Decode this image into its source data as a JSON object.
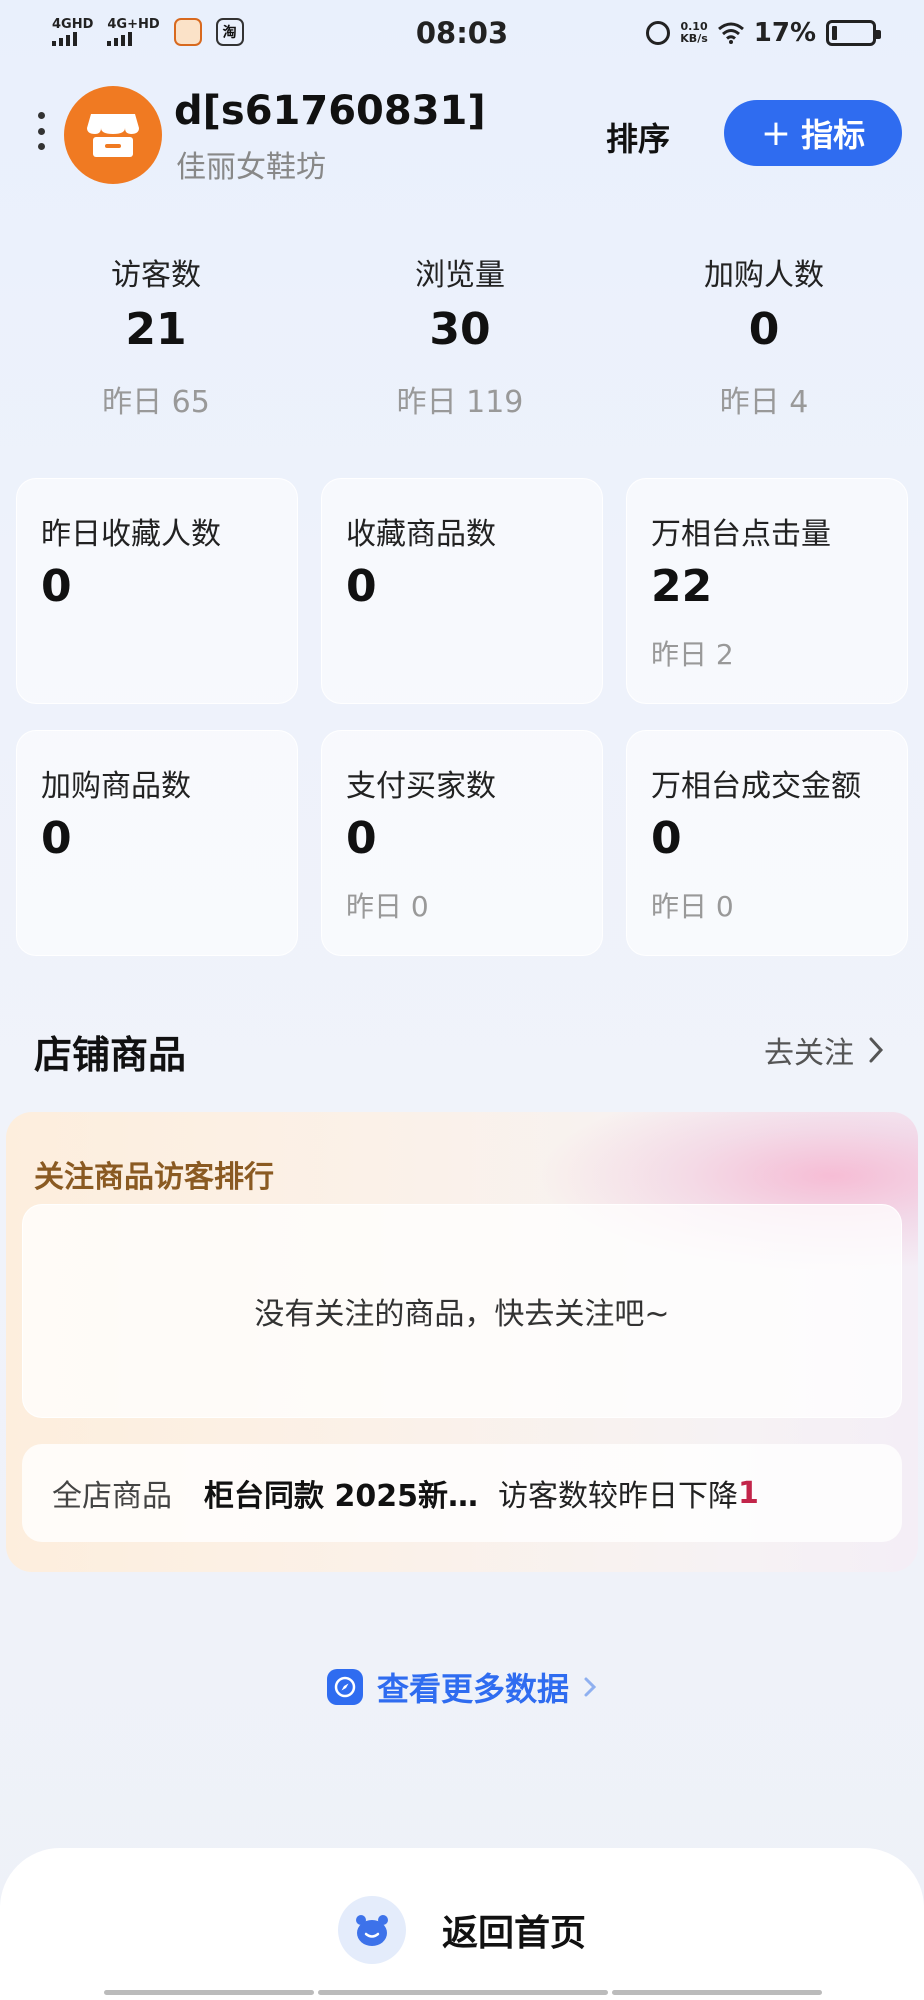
{
  "status": {
    "net1": "4GHD",
    "net2": "4G+HD",
    "app_badge": "淘",
    "time": "08:03",
    "speed_value": "0.10",
    "speed_unit": "KB/s",
    "battery": "17%"
  },
  "header": {
    "title": "d[s61760831]",
    "subtitle": "佳丽女鞋坊",
    "sort_label": "排序",
    "add_label": "指标",
    "add_icon": "plus-icon"
  },
  "top_stats": [
    {
      "label": "访客数",
      "value": "21",
      "yesterday": "昨日 65"
    },
    {
      "label": "浏览量",
      "value": "30",
      "yesterday": "昨日 119"
    },
    {
      "label": "加购人数",
      "value": "0",
      "yesterday": "昨日 4"
    }
  ],
  "cards": [
    {
      "label": "昨日收藏人数",
      "value": "0",
      "yesterday": ""
    },
    {
      "label": "收藏商品数",
      "value": "0",
      "yesterday": ""
    },
    {
      "label": "万相台点击量",
      "value": "22",
      "yesterday": "昨日 2"
    },
    {
      "label": "加购商品数",
      "value": "0",
      "yesterday": ""
    },
    {
      "label": "支付买家数",
      "value": "0",
      "yesterday": "昨日 0"
    },
    {
      "label": "万相台成交金额",
      "value": "0",
      "yesterday": "昨日 0"
    }
  ],
  "products_section": {
    "title": "店铺商品",
    "follow_link": "去关注"
  },
  "ranking": {
    "title": "关注商品访客排行",
    "empty_text": "没有关注的商品，快去关注吧~",
    "all_tag": "全店商品",
    "product": "柜台同款  2025新…",
    "desc": "访客数较昨日下降",
    "number": "1"
  },
  "more_data": "查看更多数据",
  "bottom": {
    "home_label": "返回首页"
  },
  "colors": {
    "accent": "#2f6cf0",
    "avatar": "#f07a22",
    "decrease": "#c2254a"
  }
}
